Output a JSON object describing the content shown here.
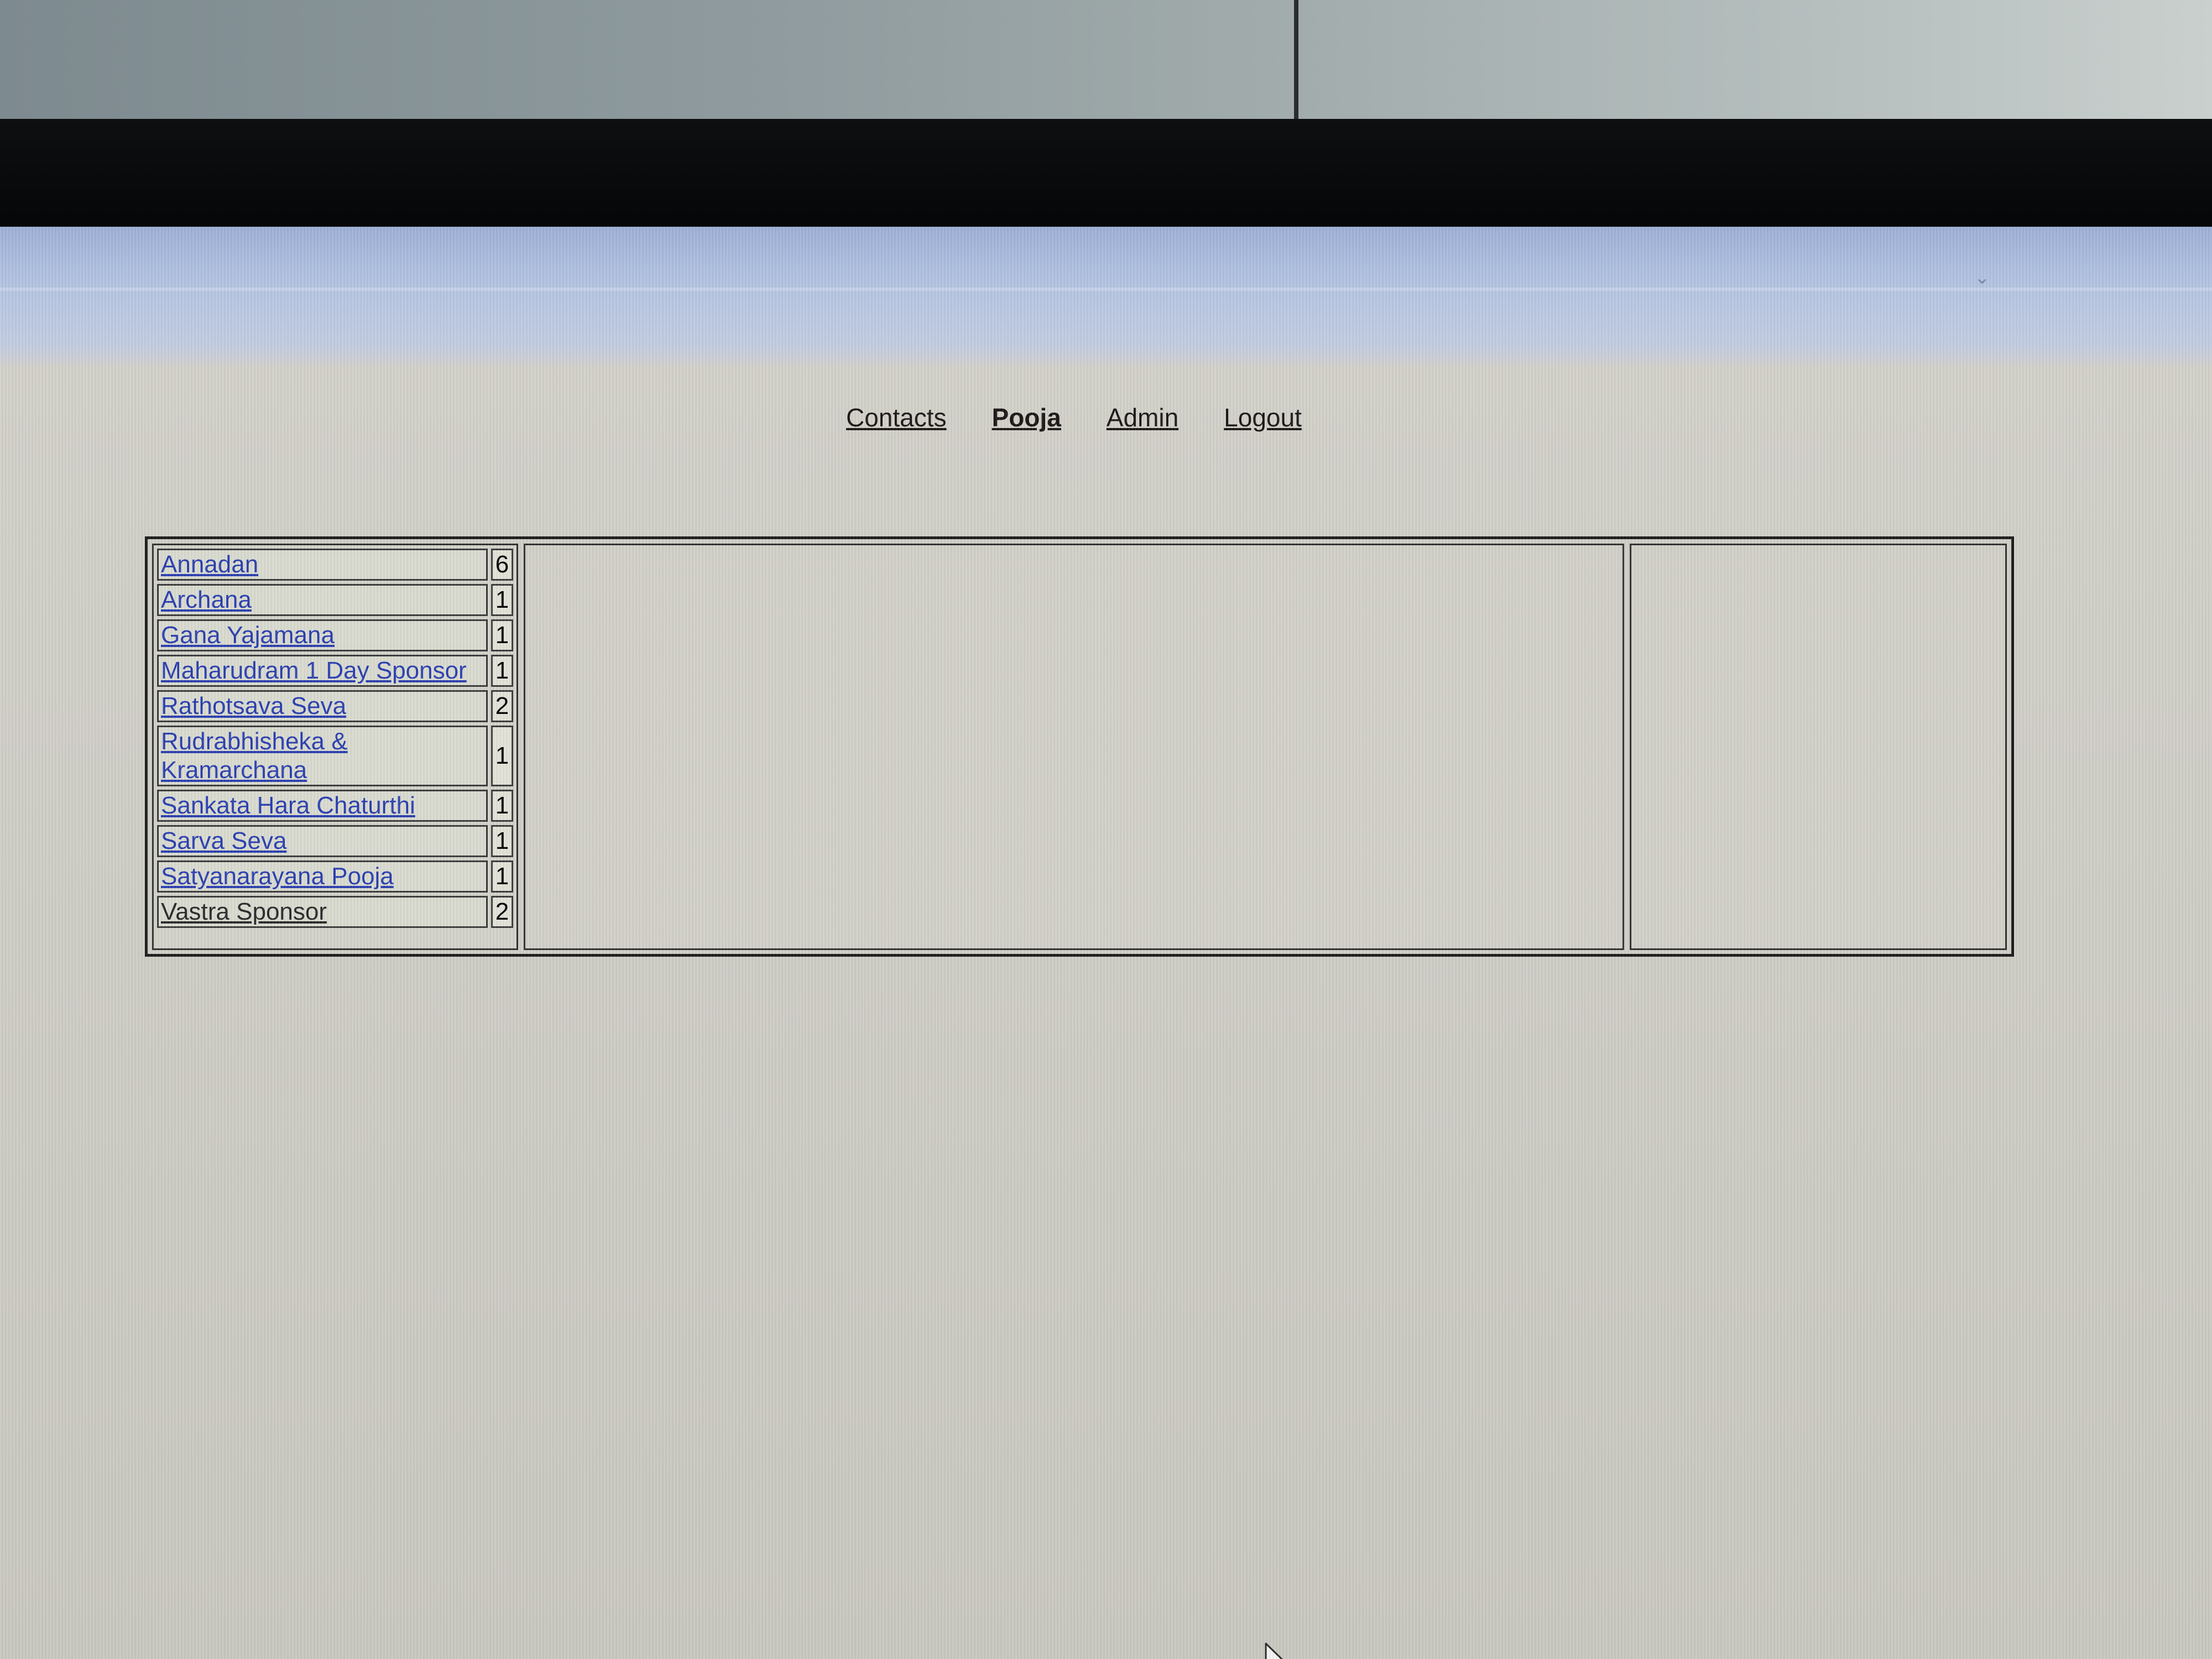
{
  "nav": {
    "items": [
      {
        "label": "Contacts",
        "active": false
      },
      {
        "label": "Pooja",
        "active": true
      },
      {
        "label": "Admin",
        "active": false
      },
      {
        "label": "Logout",
        "active": false
      }
    ]
  },
  "pooja_list": {
    "rows": [
      {
        "name": "Annadan",
        "count": "6"
      },
      {
        "name": "Archana",
        "count": "1"
      },
      {
        "name": "Gana Yajamana",
        "count": "1"
      },
      {
        "name": "Maharudram 1 Day Sponsor",
        "count": "1"
      },
      {
        "name": "Rathotsava Seva",
        "count": "2"
      },
      {
        "name": "Rudrabhisheka & Kramarchana",
        "count": "1"
      },
      {
        "name": "Sankata Hara Chaturthi",
        "count": "1"
      },
      {
        "name": "Sarva Seva",
        "count": "1"
      },
      {
        "name": "Satyanarayana Pooja",
        "count": "1"
      },
      {
        "name": "Vastra Sponsor",
        "count": "2"
      }
    ]
  },
  "icons": {
    "cursor": "mouse-pointer-icon"
  },
  "colors": {
    "link": "#2b3fb0",
    "background": "#cfcec6",
    "border": "#1c1c1c"
  }
}
